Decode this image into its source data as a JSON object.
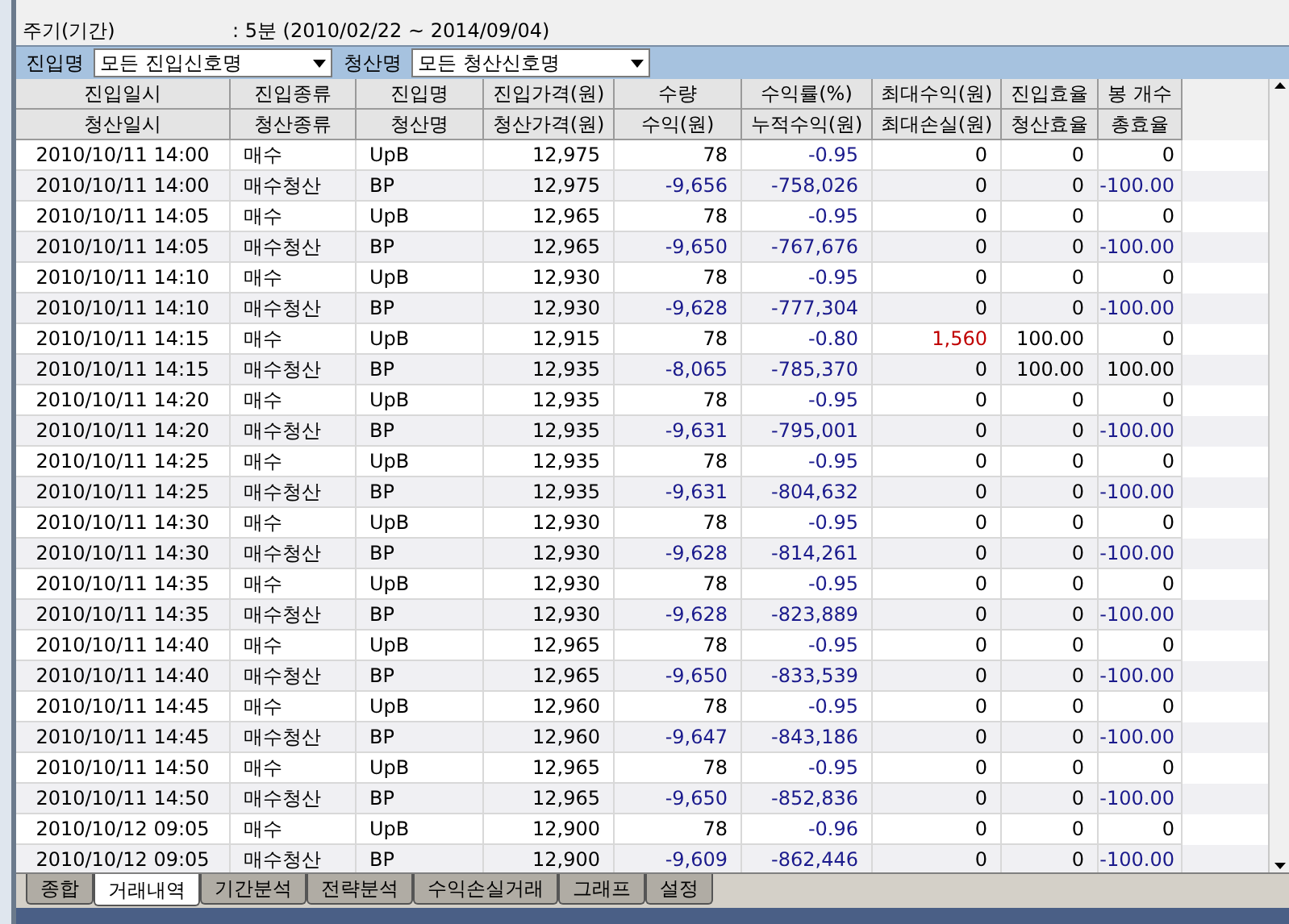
{
  "period": {
    "label": "주기(기간)",
    "value": ": 5분 (2010/02/22 ~ 2014/09/04)"
  },
  "filters": [
    {
      "label": "진입명",
      "value": "모든 진입신호명"
    },
    {
      "label": "청산명",
      "value": "모든 청산신호명"
    }
  ],
  "table": {
    "header_rows": [
      [
        "진입일시",
        "진입종류",
        "진입명",
        "진입가격(원)",
        "수량",
        "수익률(%)",
        "최대수익(원)",
        "진입효율",
        "봉 개수"
      ],
      [
        "청산일시",
        "청산종류",
        "청산명",
        "청산가격(원)",
        "수익(원)",
        "누적수익(원)",
        "최대손실(원)",
        "청산효율",
        "총효율"
      ]
    ],
    "rows": [
      [
        "2010/10/11 14:00",
        "매수",
        "UpB",
        "12,975",
        "78",
        "-0.95",
        "0",
        "0",
        "0"
      ],
      [
        "2010/10/11 14:00",
        "매수청산",
        "BP",
        "12,975",
        "-9,656",
        "-758,026",
        "0",
        "0",
        "-100.00"
      ],
      [
        "2010/10/11 14:05",
        "매수",
        "UpB",
        "12,965",
        "78",
        "-0.95",
        "0",
        "0",
        "0"
      ],
      [
        "2010/10/11 14:05",
        "매수청산",
        "BP",
        "12,965",
        "-9,650",
        "-767,676",
        "0",
        "0",
        "-100.00"
      ],
      [
        "2010/10/11 14:10",
        "매수",
        "UpB",
        "12,930",
        "78",
        "-0.95",
        "0",
        "0",
        "0"
      ],
      [
        "2010/10/11 14:10",
        "매수청산",
        "BP",
        "12,930",
        "-9,628",
        "-777,304",
        "0",
        "0",
        "-100.00"
      ],
      [
        "2010/10/11 14:15",
        "매수",
        "UpB",
        "12,915",
        "78",
        "-0.80",
        "1,560",
        "100.00",
        "0"
      ],
      [
        "2010/10/11 14:15",
        "매수청산",
        "BP",
        "12,935",
        "-8,065",
        "-785,370",
        "0",
        "100.00",
        "100.00"
      ],
      [
        "2010/10/11 14:20",
        "매수",
        "UpB",
        "12,935",
        "78",
        "-0.95",
        "0",
        "0",
        "0"
      ],
      [
        "2010/10/11 14:20",
        "매수청산",
        "BP",
        "12,935",
        "-9,631",
        "-795,001",
        "0",
        "0",
        "-100.00"
      ],
      [
        "2010/10/11 14:25",
        "매수",
        "UpB",
        "12,935",
        "78",
        "-0.95",
        "0",
        "0",
        "0"
      ],
      [
        "2010/10/11 14:25",
        "매수청산",
        "BP",
        "12,935",
        "-9,631",
        "-804,632",
        "0",
        "0",
        "-100.00"
      ],
      [
        "2010/10/11 14:30",
        "매수",
        "UpB",
        "12,930",
        "78",
        "-0.95",
        "0",
        "0",
        "0"
      ],
      [
        "2010/10/11 14:30",
        "매수청산",
        "BP",
        "12,930",
        "-9,628",
        "-814,261",
        "0",
        "0",
        "-100.00"
      ],
      [
        "2010/10/11 14:35",
        "매수",
        "UpB",
        "12,930",
        "78",
        "-0.95",
        "0",
        "0",
        "0"
      ],
      [
        "2010/10/11 14:35",
        "매수청산",
        "BP",
        "12,930",
        "-9,628",
        "-823,889",
        "0",
        "0",
        "-100.00"
      ],
      [
        "2010/10/11 14:40",
        "매수",
        "UpB",
        "12,965",
        "78",
        "-0.95",
        "0",
        "0",
        "0"
      ],
      [
        "2010/10/11 14:40",
        "매수청산",
        "BP",
        "12,965",
        "-9,650",
        "-833,539",
        "0",
        "0",
        "-100.00"
      ],
      [
        "2010/10/11 14:45",
        "매수",
        "UpB",
        "12,960",
        "78",
        "-0.95",
        "0",
        "0",
        "0"
      ],
      [
        "2010/10/11 14:45",
        "매수청산",
        "BP",
        "12,960",
        "-9,647",
        "-843,186",
        "0",
        "0",
        "-100.00"
      ],
      [
        "2010/10/11 14:50",
        "매수",
        "UpB",
        "12,965",
        "78",
        "-0.95",
        "0",
        "0",
        "0"
      ],
      [
        "2010/10/11 14:50",
        "매수청산",
        "BP",
        "12,965",
        "-9,650",
        "-852,836",
        "0",
        "0",
        "-100.00"
      ],
      [
        "2010/10/12 09:05",
        "매수",
        "UpB",
        "12,900",
        "78",
        "-0.96",
        "0",
        "0",
        "0"
      ],
      [
        "2010/10/12 09:05",
        "매수청산",
        "BP",
        "12,900",
        "-9,609",
        "-862,446",
        "0",
        "0",
        "-100.00"
      ]
    ]
  },
  "tabs": [
    {
      "label": "종합",
      "selected": false
    },
    {
      "label": "거래내역",
      "selected": true
    },
    {
      "label": "기간분석",
      "selected": false
    },
    {
      "label": "전략분석",
      "selected": false
    },
    {
      "label": "수익손실거래",
      "selected": false
    },
    {
      "label": "그래프",
      "selected": false
    },
    {
      "label": "설정",
      "selected": false
    }
  ]
}
